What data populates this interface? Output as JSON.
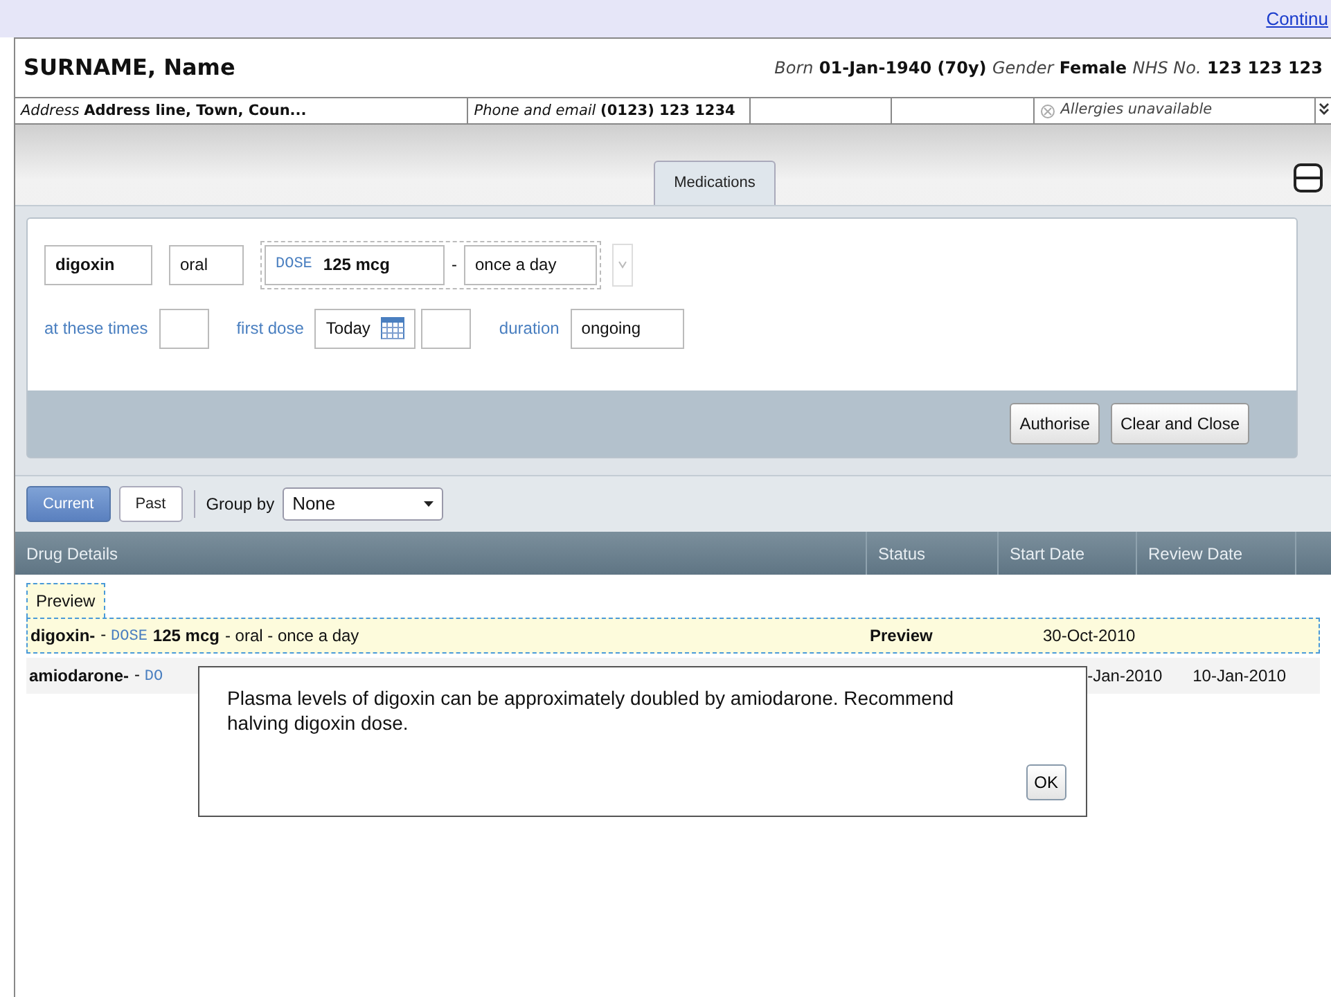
{
  "header_link": "Continu",
  "patient": {
    "name": "SURNAME, Name",
    "details": [
      {
        "label": "Born",
        "value": "01-Jan-1940 (70y)"
      },
      {
        "label": "Gender",
        "value": "Female"
      },
      {
        "label": "NHS No.",
        "value": "123 123 123"
      }
    ]
  },
  "contact_bar": {
    "address_label": "Address",
    "address": "Address line, Town, Coun...",
    "phone_label": "Phone and email",
    "phone": "(0123) 123 1234",
    "allergies": "Allergies unavailable"
  },
  "tabs": [
    {
      "label": "Medications",
      "selected": true
    }
  ],
  "prescription_form": {
    "drug": "digoxin",
    "route": "oral",
    "dose_label": "DOSE",
    "dose": "125 mcg",
    "separator": "-",
    "frequency": "once a day",
    "times_label": "at these times",
    "first_dose_label": "first dose",
    "first_dose": "Today",
    "duration_label": "duration",
    "duration": "ongoing",
    "buttons": [
      "Authorise",
      "Clear and Close"
    ]
  },
  "list_filter": {
    "tabs": [
      {
        "label": "Current",
        "selected": true
      },
      {
        "label": "Past",
        "selected": false
      }
    ],
    "group_by_label": "Group by",
    "group_by": "None"
  },
  "table": {
    "columns": [
      "Drug Details",
      "Status",
      "Start Date",
      "Review Date"
    ],
    "preview_tag": "Preview",
    "rows": [
      {
        "kind": "preview",
        "drug": "digoxin-",
        "dose_prefix": "-",
        "dose_label": "DOSE",
        "dose": "125 mcg",
        "details": "- oral - once a day",
        "status": "Preview",
        "start_date": "30-Oct-2010"
      },
      {
        "kind": "current",
        "drug": "amiodarone-",
        "dose_prefix": "-",
        "dose_label": "DO",
        "start_date": "-Jan-2010",
        "review_date": "10-Jan-2010"
      }
    ]
  },
  "alert": {
    "message": "Plasma levels of digoxin can be approximately doubled by amiodarone.  Recommend halving digoxin dose.",
    "button": "OK"
  }
}
